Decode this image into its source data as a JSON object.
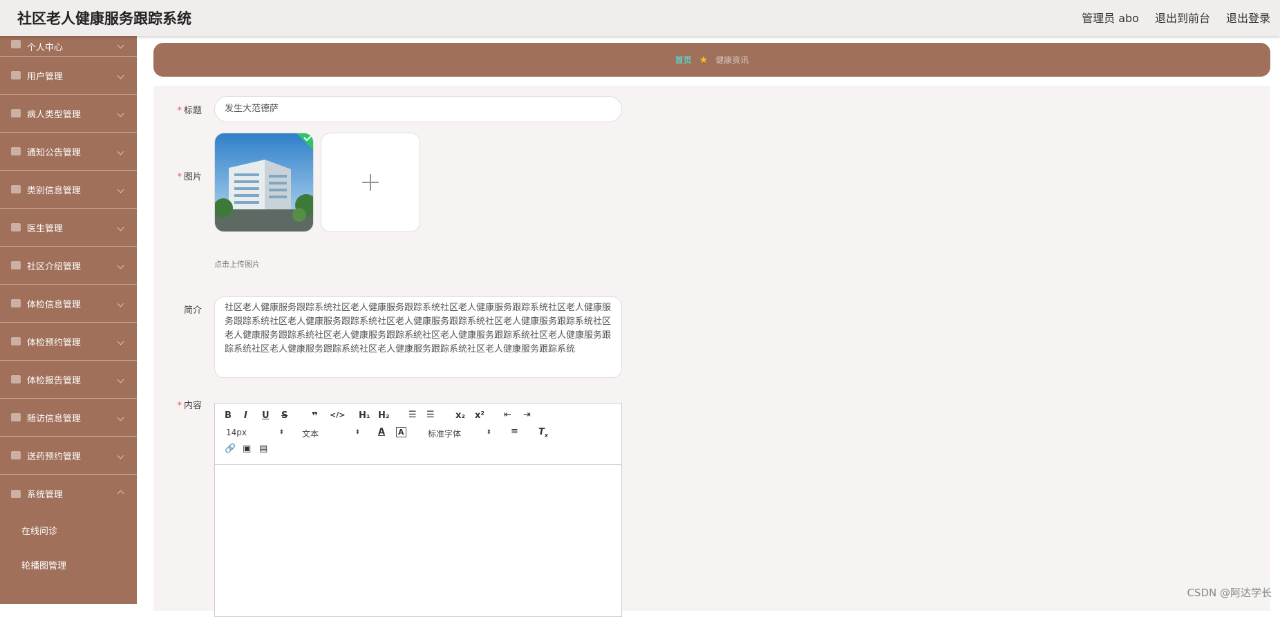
{
  "app": {
    "title": "社区老人健康服务跟踪系统"
  },
  "header": {
    "links": [
      "管理员 abo",
      "退出到前台",
      "退出登录"
    ]
  },
  "sidebar": {
    "items": [
      {
        "label": "个人中心",
        "icon": "user-icon"
      },
      {
        "label": "用户管理",
        "icon": "id-card-icon"
      },
      {
        "label": "病人类型管理",
        "icon": "monitor-icon"
      },
      {
        "label": "通知公告管理",
        "icon": "frame-icon"
      },
      {
        "label": "类别信息管理",
        "icon": "grid-icon"
      },
      {
        "label": "医生管理",
        "icon": "briefcase-icon"
      },
      {
        "label": "社区介绍管理",
        "icon": "bell-icon"
      },
      {
        "label": "体检信息管理",
        "icon": "crop-icon"
      },
      {
        "label": "体检预约管理",
        "icon": "flag-icon"
      },
      {
        "label": "体检报告管理",
        "icon": "clipboard-icon"
      },
      {
        "label": "随访信息管理",
        "icon": "send-icon"
      },
      {
        "label": "送药预约管理",
        "icon": "power-icon"
      },
      {
        "label": "系统管理",
        "icon": "chat-icon"
      }
    ],
    "subitems": [
      "在线问诊",
      "轮播图管理"
    ]
  },
  "breadcrumb": {
    "home": "首页",
    "current": "健康资讯"
  },
  "form": {
    "title_label": "标题",
    "title_value": "发生大范德萨",
    "image_label": "图片",
    "upload_hint": "点击上传图片",
    "intro_label": "简介",
    "intro_value": "社区老人健康服务跟踪系统社区老人健康服务跟踪系统社区老人健康服务跟踪系统社区老人健康服务跟踪系统社区老人健康服务跟踪系统社区老人健康服务跟踪系统社区老人健康服务跟踪系统社区老人健康服务跟踪系统社区老人健康服务跟踪系统社区老人健康服务跟踪系统社区老人健康服务跟踪系统社区老人健康服务跟踪系统社区老人健康服务跟踪系统社区老人健康服务跟踪系统",
    "content_label": "内容"
  },
  "editor": {
    "font_size": "14px",
    "header_select": "文本",
    "font_family": "标准字体"
  },
  "colors": {
    "sidebar": "#a0705a",
    "accent": "#5dd1c6",
    "required": "#e55555"
  },
  "watermark": "CSDN @阿达学长"
}
